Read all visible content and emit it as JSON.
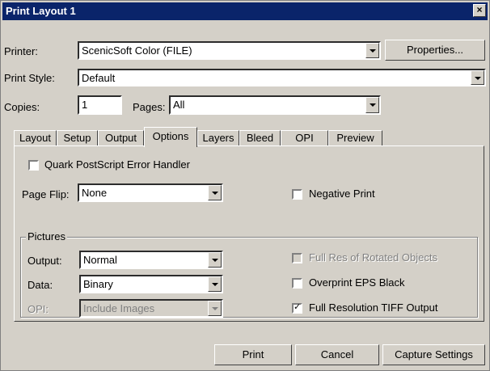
{
  "window": {
    "title": "Print Layout 1",
    "close_glyph": "×"
  },
  "printer": {
    "label": "Printer:",
    "value": "ScenicSoft Color (FILE)",
    "properties_button": "Properties..."
  },
  "print_style": {
    "label": "Print Style:",
    "value": "Default"
  },
  "copies": {
    "label": "Copies:",
    "value": "1"
  },
  "pages": {
    "label": "Pages:",
    "value": "All"
  },
  "tabs": [
    {
      "label": "Layout",
      "selected": false
    },
    {
      "label": "Setup",
      "selected": false
    },
    {
      "label": "Output",
      "selected": false
    },
    {
      "label": "Options",
      "selected": true
    },
    {
      "label": "Layers",
      "selected": false
    },
    {
      "label": "Bleed",
      "selected": false
    },
    {
      "label": "OPI",
      "selected": false
    },
    {
      "label": "Preview",
      "selected": false
    }
  ],
  "options": {
    "quark_error_handler": {
      "label": "Quark PostScript Error Handler",
      "checked": false
    },
    "page_flip": {
      "label": "Page Flip:",
      "value": "None"
    },
    "negative_print": {
      "label": "Negative Print",
      "checked": false
    }
  },
  "pictures": {
    "legend": "Pictures",
    "output": {
      "label": "Output:",
      "value": "Normal"
    },
    "data": {
      "label": "Data:",
      "value": "Binary"
    },
    "opi": {
      "label": "OPI:",
      "value": "Include Images",
      "disabled": true
    },
    "full_res_rotated": {
      "label": "Full Res of Rotated Objects",
      "checked": false,
      "disabled": true
    },
    "overprint_eps_black": {
      "label": "Overprint EPS Black",
      "checked": false
    },
    "full_resolution_tiff": {
      "label": "Full Resolution TIFF Output",
      "checked": true
    },
    "check_glyph": "✓"
  },
  "buttons": {
    "print": "Print",
    "cancel": "Cancel",
    "capture": "Capture Settings"
  }
}
